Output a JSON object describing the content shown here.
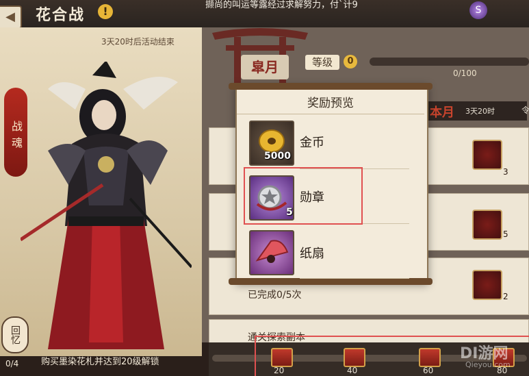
{
  "header": {
    "back_icon": "arrow-left-icon",
    "title": "花合战",
    "info_icon": "exclamation-icon",
    "info_glyph": "!",
    "top_text": "撷尚的叫运等露经过求解努力，付`计9",
    "currency_icon": "purple-gem-icon",
    "currency_glyph": "S"
  },
  "left": {
    "event_end": "3天20时后活动结束",
    "tab_label": "战魂",
    "memory_label": "回忆",
    "counter": "0/4",
    "unlock_text": "购买墨染花札并达到20级解锁"
  },
  "right": {
    "month_tab": "皐月",
    "level_label": "等级",
    "level_value": "0",
    "level_progress": "0/100",
    "level_fraction": 0,
    "tab_month_label": "本月",
    "tab_month_time": "3天20时",
    "tab_ling": "令",
    "rows": [
      {
        "count": "3"
      },
      {
        "count": "5"
      },
      {
        "count": "2",
        "text": "已完成0/5次"
      },
      {
        "text": "通关探索副本"
      }
    ]
  },
  "modal": {
    "title": "奖励预览",
    "items": [
      {
        "name": "金币",
        "qty": "5000",
        "icon": "gold-coin-icon"
      },
      {
        "name": "勋章",
        "qty": "5",
        "icon": "medal-icon"
      },
      {
        "name": "纸扇",
        "qty": "",
        "icon": "paper-fan-icon"
      }
    ]
  },
  "bottom": {
    "chests": [
      {
        "label": "20"
      },
      {
        "label": "40"
      },
      {
        "label": "60"
      },
      {
        "label": "80"
      }
    ],
    "watermark": "DI游网",
    "watermark_sub": "Qieyou.com"
  },
  "colors": {
    "accent_red": "#c9442d",
    "highlight_red": "#e05050",
    "gold": "#e8b93d"
  }
}
